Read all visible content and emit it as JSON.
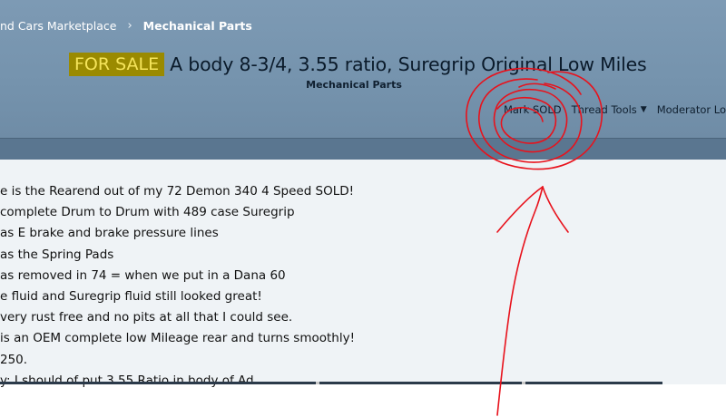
{
  "breadcrumb": {
    "items": [
      "nd Cars Marketplace",
      "Mechanical Parts"
    ]
  },
  "thread": {
    "prefix": "FOR SALE",
    "title": "A body 8-3/4, 3.55 ratio, Suregrip Original Low Miles",
    "forum": "Mechanical Parts"
  },
  "tools": {
    "mark_sold": "Mark SOLD",
    "thread_tools": "Thread Tools",
    "moderator": "Moderator Lo"
  },
  "post": {
    "lines": [
      "e is the Rearend out of my 72 Demon 340 4 Speed SOLD!",
      "complete Drum to Drum with 489 case Suregrip",
      "as E brake and brake pressure lines",
      "as the Spring Pads",
      "as removed in 74 = when we put in a Dana 60",
      "e fluid and Suregrip fluid still looked great!",
      "very rust free and no pits at all that I could see.",
      "is an OEM complete low Mileage rear and turns smoothly!",
      "250.",
      "y: I should of put 3.55 Ratio in body of Ad."
    ]
  },
  "colors": {
    "header": "#7593ad",
    "strip": "#5a7690",
    "prefix_bg": "#9a8a00",
    "prefix_text": "#f5e45a",
    "annotation": "#e8121c"
  },
  "icons": {
    "crumb_separator": "chevron-right-icon",
    "menu_indicator": "chevron-down-icon"
  }
}
